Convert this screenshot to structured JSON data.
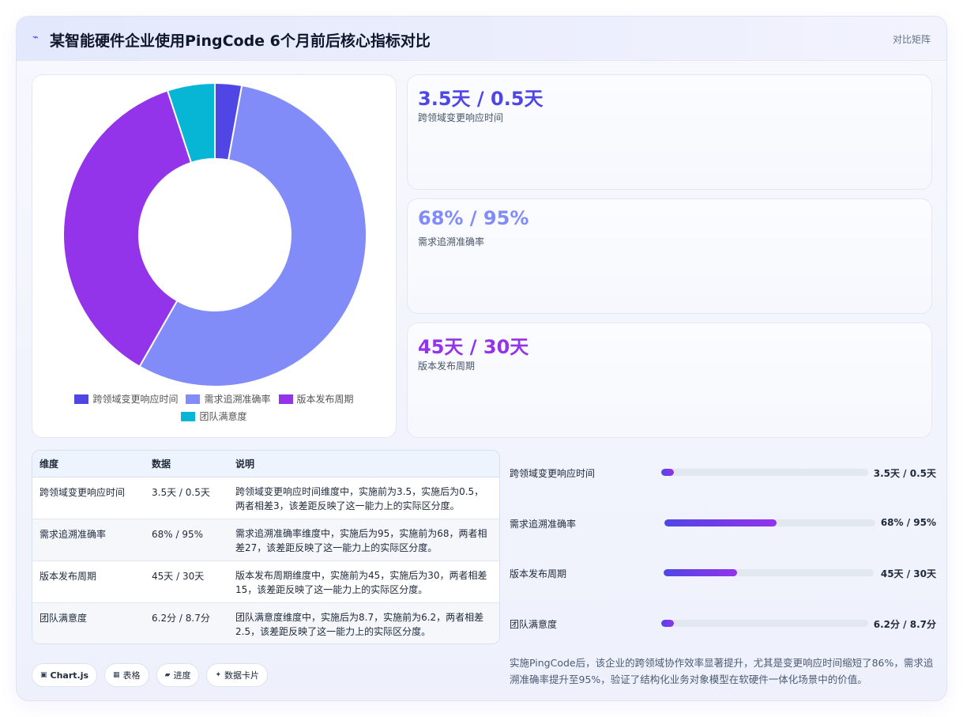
{
  "header": {
    "icon": "trend-icon",
    "title": "某智能硬件企业使用PingCode 6个月前后核心指标对比",
    "action_label": "对比矩阵"
  },
  "colors": {
    "indigo": "#4f46e5",
    "periwinkle": "#818cf8",
    "purple": "#9333ea",
    "cyan": "#06b6d4"
  },
  "chart_data": {
    "type": "pie",
    "donut": true,
    "categories": [
      "跨领域变更响应时间",
      "需求追溯准确率",
      "版本发布周期",
      "团队满意度"
    ],
    "values": [
      3.5,
      68,
      45,
      6.2
    ],
    "colors": [
      "#4f46e5",
      "#818cf8",
      "#9333ea",
      "#06b6d4"
    ],
    "legend_position": "bottom"
  },
  "stats": [
    {
      "value": "3.5天 / 0.5天",
      "label": "跨领域变更响应时间",
      "color": "#4f46e5"
    },
    {
      "value": "68% / 95%",
      "label": "需求追溯准确率",
      "color": "#818cf8"
    },
    {
      "value": "45天 / 30天",
      "label": "版本发布周期",
      "color": "#9333ea"
    }
  ],
  "table": {
    "headers": [
      "维度",
      "数据",
      "说明"
    ],
    "rows": [
      [
        "跨领域变更响应时间",
        "3.5天 / 0.5天",
        "跨领域变更响应时间维度中，实施前为3.5，实施后为0.5，两者相差3，该差距反映了这一能力上的实际区分度。"
      ],
      [
        "需求追溯准确率",
        "68% / 95%",
        "需求追溯准确率维度中，实施后为95，实施前为68，两者相差27，该差距反映了这一能力上的实际区分度。"
      ],
      [
        "版本发布周期",
        "45天 / 30天",
        "版本发布周期维度中，实施前为45，实施后为30，两者相差15，该差距反映了这一能力上的实际区分度。"
      ],
      [
        "团队满意度",
        "6.2分 / 8.7分",
        "团队满意度维度中，实施后为8.7，实施前为6.2，两者相差2.5，该差距反映了这一能力上的实际区分度。"
      ]
    ]
  },
  "progress": [
    {
      "label": "跨领域变更响应时间",
      "value": "3.5天 / 0.5天",
      "fraction": 0.06
    },
    {
      "label": "需求追溯准确率",
      "value": "68% / 95%",
      "fraction": 0.53
    },
    {
      "label": "版本发布周期",
      "value": "45天 / 30天",
      "fraction": 0.35
    },
    {
      "label": "团队满意度",
      "value": "6.2分 / 8.7分",
      "fraction": 0.06
    }
  ],
  "summary": "实施PingCode后，该企业的跨领域协作效率显著提升，尤其是变更响应时间缩短了86%，需求追溯准确率提升至95%，验证了结构化业务对象模型在软硬件一体化场景中的价值。",
  "chips": [
    {
      "icon": "chart-icon",
      "glyph": "▣",
      "label": "Chart.js"
    },
    {
      "icon": "table-icon",
      "glyph": "▦",
      "label": "表格"
    },
    {
      "icon": "progress-icon",
      "glyph": "▰",
      "label": "进度"
    },
    {
      "icon": "sparkle-icon",
      "glyph": "✦",
      "label": "数据卡片"
    }
  ]
}
